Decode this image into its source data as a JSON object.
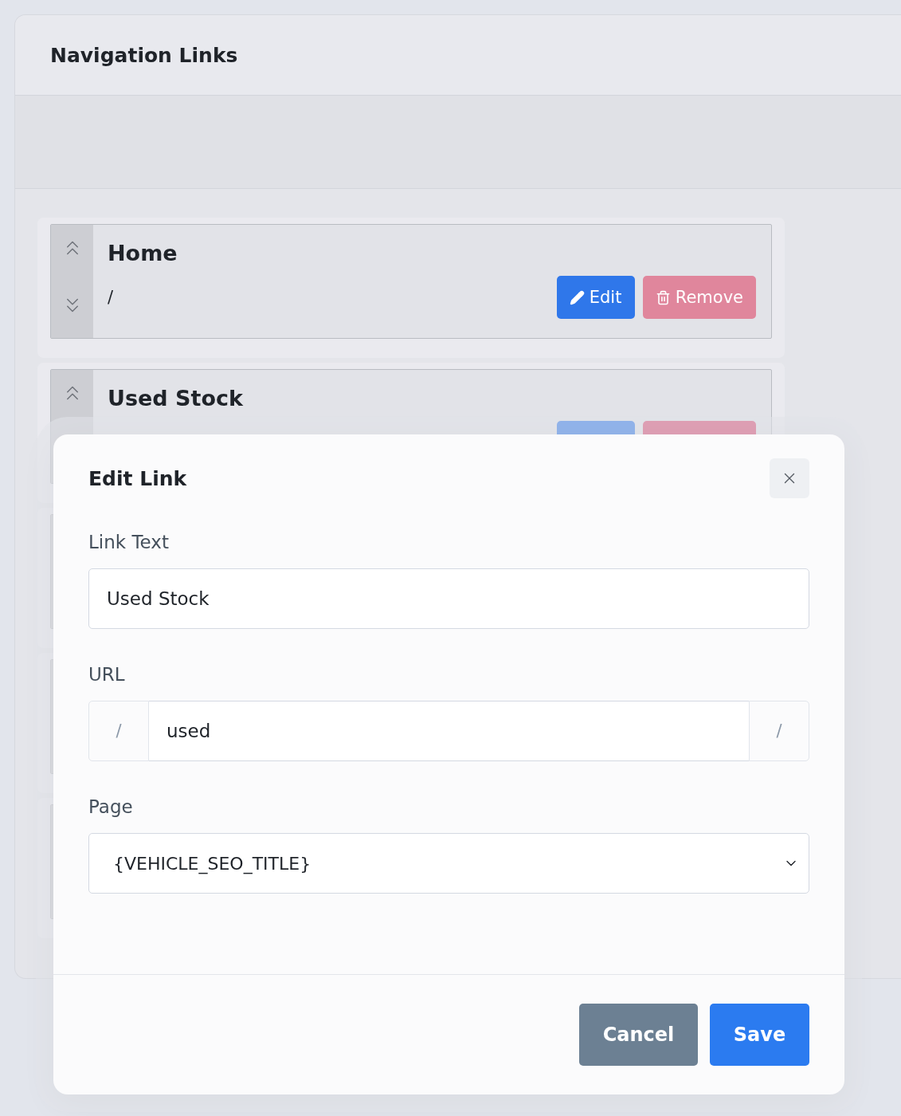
{
  "card": {
    "title": "Navigation Links"
  },
  "links": [
    {
      "kind": "link",
      "text": "Home",
      "url": "/",
      "edit_label": "Edit",
      "remove_label": "Remove",
      "remove_disabled": true
    },
    {
      "kind": "link",
      "text": "Used Stock",
      "remove_disabled": false
    },
    {
      "kind": "covered"
    },
    {
      "kind": "covered"
    },
    {
      "kind": "covered"
    }
  ],
  "modal": {
    "title": "Edit Link",
    "fields": [
      {
        "kind": "text",
        "label": "Link Text",
        "value": "Used Stock"
      },
      {
        "kind": "addon",
        "label": "URL",
        "prefix": "/",
        "value": "used",
        "suffix": "/"
      },
      {
        "kind": "select",
        "label": "Page",
        "value": "{VEHICLE_SEO_TITLE}"
      }
    ],
    "buttons": [
      {
        "kind": "secondary",
        "label": "Cancel"
      },
      {
        "kind": "primary",
        "label": "Save"
      }
    ]
  }
}
